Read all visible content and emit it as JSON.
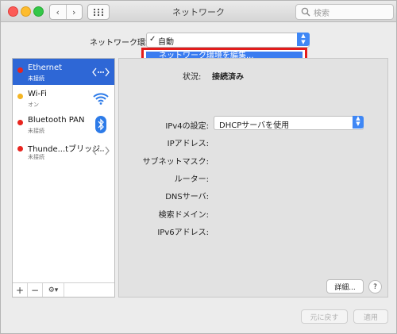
{
  "window": {
    "title": "ネットワーク"
  },
  "toolbar": {
    "back_glyph": "‹",
    "forward_glyph": "›",
    "search_placeholder": "検索"
  },
  "location": {
    "label": "ネットワーク環境",
    "check": "✓",
    "value": "自動",
    "menu_item": "ネットワーク環境を編集..."
  },
  "services": [
    {
      "name": "Ethernet",
      "status": "未接続",
      "dot_color": "#e8251f",
      "icon": "ethernet-icon"
    },
    {
      "name": "Wi-Fi",
      "status": "オン",
      "dot_color": "#f4b524",
      "icon": "wifi-icon"
    },
    {
      "name": "Bluetooth PAN",
      "status": "未接続",
      "dot_color": "#e8251f",
      "icon": "bluetooth-icon"
    },
    {
      "name": "Thunde...tブリッジ",
      "status": "未接続",
      "dot_color": "#e8251f",
      "icon": "thunderbolt-bridge-icon"
    }
  ],
  "sidebar_footer": {
    "add": "+",
    "remove": "−",
    "gear": "⚙▾"
  },
  "detail": {
    "status_label": "状況:",
    "status_value": "接続済み",
    "ipv4_label": "IPv4の設定:",
    "ipv4_value": "DHCPサーバを使用",
    "fields": [
      "IPアドレス:",
      "サブネットマスク:",
      "ルーター:",
      "DNSサーバ:",
      "検索ドメイン:",
      "IPv6アドレス:"
    ],
    "advanced_button": "詳細...",
    "help_button": "?"
  },
  "footer": {
    "revert_button": "元に戻す",
    "apply_button": "適用"
  },
  "colors": {
    "selection": "#2e67d6",
    "highlight_box": "#e31c1c",
    "accent": "#3f87f5"
  }
}
